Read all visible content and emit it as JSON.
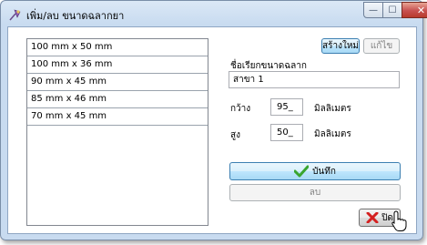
{
  "window": {
    "title": "เพิ่ม/ลบ ขนาดฉลากยา",
    "minimize_glyph": "—",
    "maximize_glyph": "☐",
    "close_glyph": "✕"
  },
  "list": {
    "items": [
      {
        "label": "100 mm x 50 mm"
      },
      {
        "label": "100 mm x 36 mm"
      },
      {
        "label": "90 mm x 45 mm"
      },
      {
        "label": "85 mm x 46 mm"
      },
      {
        "label": "70 mm x 45 mm"
      }
    ]
  },
  "form": {
    "new_label": "สร้างใหม่",
    "edit_label": "แก้ไข",
    "name_label": "ชื่อเรียกขนาดฉลาก",
    "name_value": "สาขา 1",
    "width_label": "กว้าง",
    "width_value": "95_",
    "width_unit": "มิลลิเมตร",
    "height_label": "สูง",
    "height_value": "50_",
    "height_unit": "มิลลิเมตร",
    "save_label": "บันทึก",
    "delete_label": "ลบ",
    "close_label": "ปิด"
  },
  "icons": {
    "app": "pin-icon",
    "save": "check-icon",
    "close": "x-icon",
    "cursor": "hand-pointer-icon"
  },
  "colors": {
    "check": "#3aa52f",
    "x_mark": "#d42020",
    "window_frame": "#c8dbf0"
  }
}
